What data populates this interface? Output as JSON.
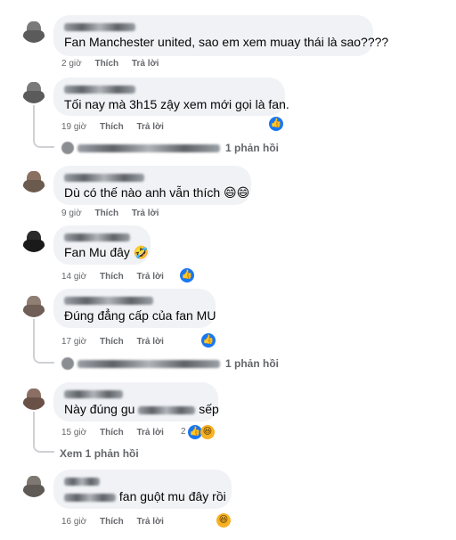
{
  "comments": [
    {
      "text": "Fan Manchester united, sao em xem muay thái là sao????",
      "time": "2 giờ",
      "like": "Thích",
      "reply": "Trả lời"
    },
    {
      "text": "Tối nay mà 3h15 zậy xem mới gọi là fan.",
      "time": "19 giờ",
      "like": "Thích",
      "reply": "Trả lời",
      "replies": "1 phản hồi"
    },
    {
      "text": "Dù có thế nào anh vẫn thích 😄😄",
      "time": "9 giờ",
      "like": "Thích",
      "reply": "Trả lời"
    },
    {
      "text": "Fan Mu đây 🤣",
      "time": "14 giờ",
      "like": "Thích",
      "reply": "Trả lời"
    },
    {
      "text": "Đúng đẳng cấp của fan MU",
      "time": "17 giờ",
      "like": "Thích",
      "reply": "Trả lời",
      "replies": "1 phản hồi"
    },
    {
      "text": "Này đúng gu",
      "text_end": "sếp",
      "time": "15 giờ",
      "like": "Thích",
      "reply": "Trả lời",
      "reaction_count": "2",
      "view_more": "Xem 1 phản hồi"
    },
    {
      "text": "fan guột mu đây rồi",
      "time": "16 giờ",
      "like": "Thích",
      "reply": "Trả lời"
    }
  ],
  "icons": {
    "like": "like-reaction-icon",
    "haha": "haha-reaction-icon",
    "like_color": "#1877f2",
    "haha_color": "#f7b125"
  }
}
